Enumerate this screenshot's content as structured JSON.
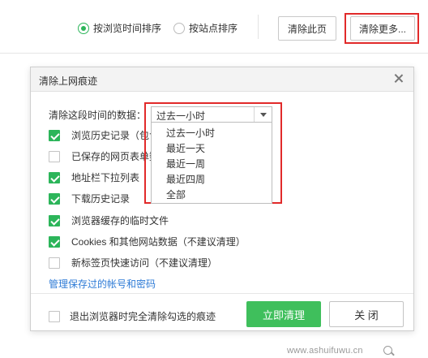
{
  "toolbar": {
    "sort_by_time_label": "按浏览时间排序",
    "sort_by_site_label": "按站点排序",
    "clear_page_label": "清除此页",
    "clear_more_label": "清除更多..."
  },
  "dialog": {
    "title": "清除上网痕迹",
    "range_label": "清除这段时间的数据：",
    "selected_range": "过去一小时",
    "range_options": [
      "过去一小时",
      "最近一天",
      "最近一周",
      "最近四周",
      "全部"
    ],
    "checkboxes": [
      {
        "label": "浏览历史记录（包含",
        "checked": true
      },
      {
        "label": "已保存的网页表单数",
        "checked": false
      },
      {
        "label": "地址栏下拉列表",
        "checked": true
      },
      {
        "label": "下载历史记录",
        "checked": true
      },
      {
        "label": "浏览器缓存的临时文件",
        "checked": true
      },
      {
        "label": "Cookies 和其他网站数据（不建议清理）",
        "checked": true
      },
      {
        "label": "新标签页快速访问（不建议清理）",
        "checked": false
      }
    ],
    "manage_link": "管理保存过的帐号和密码",
    "exit_clear_label": "退出浏览器时完全清除勾选的痕迹",
    "clear_now_label": "立即清理",
    "close_label": "关 闭"
  },
  "watermark": "www.ashuifuwu.cn",
  "colors": {
    "accent_green": "#2cb55a",
    "highlight_red": "#e12a2a",
    "link_blue": "#2e7bd6"
  }
}
